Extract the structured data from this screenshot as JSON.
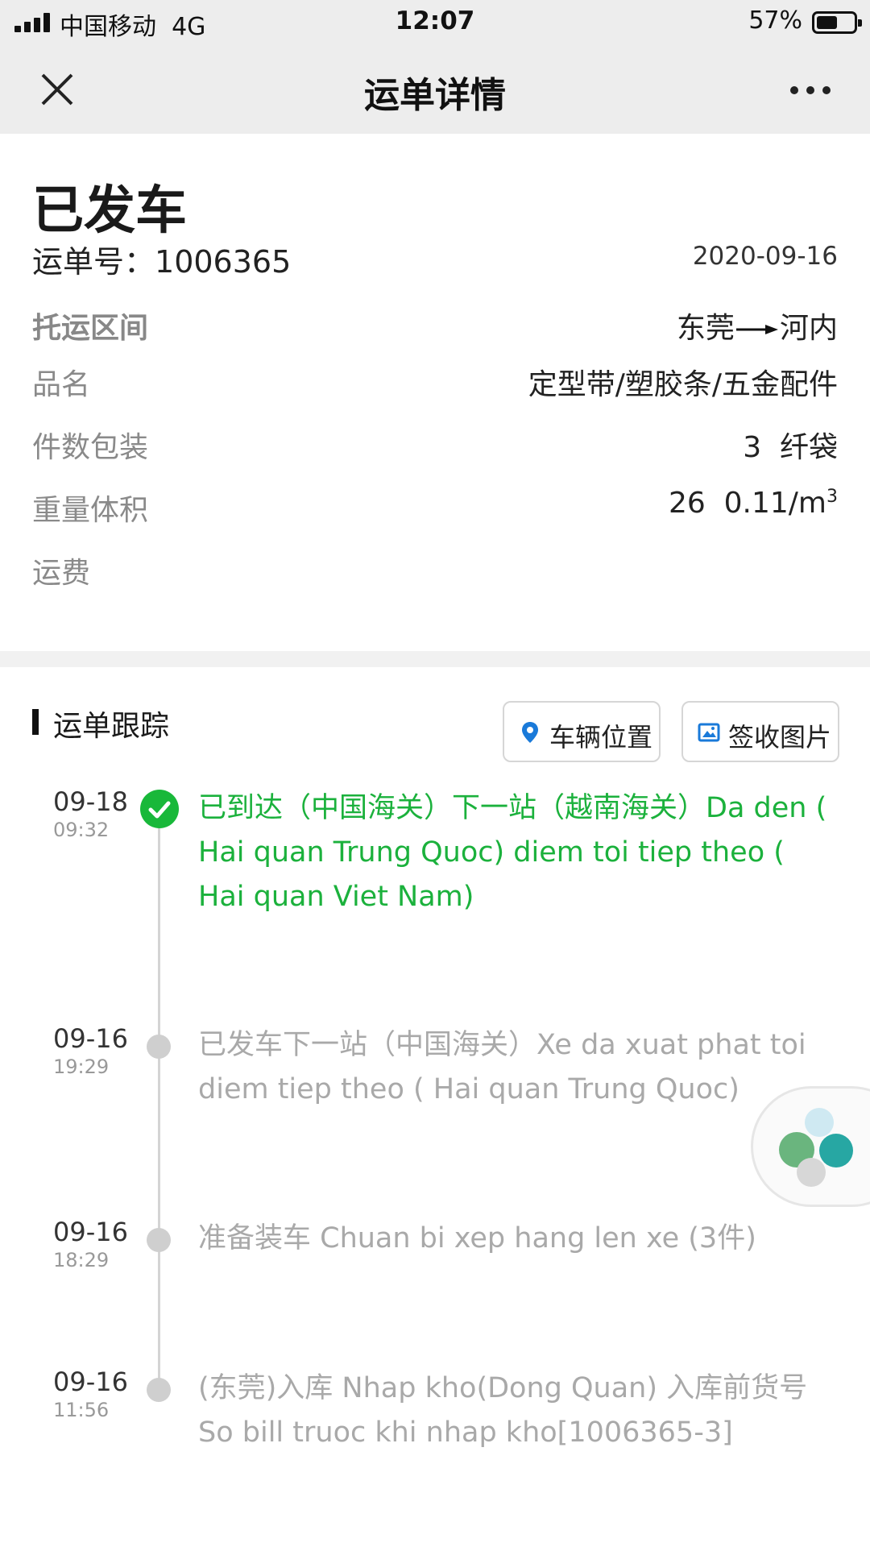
{
  "status_bar": {
    "carrier": "中国移动",
    "network": "4G",
    "time": "12:07",
    "battery": "57%",
    "battery_level": 0.57
  },
  "nav": {
    "title": "运单详情"
  },
  "summary": {
    "status": "已发车",
    "waybill_label": "运单号：",
    "waybill_no": "1006365",
    "date": "2020-09-16",
    "route": {
      "label": "托运区间",
      "from": "东莞",
      "to": "河内"
    },
    "product": {
      "label": "品名",
      "value": "定型带/塑胶条/五金配件"
    },
    "package": {
      "label": "件数包装",
      "value": "3  纤袋"
    },
    "weight": {
      "label": "重量体积",
      "value": "26  0.11/m",
      "unit_sup": "3"
    },
    "freight": {
      "label": "运费",
      "value": ""
    }
  },
  "tracking": {
    "title": "运单跟踪",
    "vehicle_button": "车辆位置",
    "photo_button": "签收图片",
    "events": [
      {
        "date": "09-18",
        "time": "09:32",
        "text": "已到达（中国海关）下一站（越南海关）Da den ( Hai quan Trung Quoc) diem toi tiep theo ( Hai quan Viet Nam)",
        "current": true
      },
      {
        "date": "09-16",
        "time": "19:29",
        "text": "已发车下一站（中国海关）Xe da xuat phat toi diem tiep theo ( Hai quan Trung Quoc)",
        "current": false
      },
      {
        "date": "09-16",
        "time": "18:29",
        "text": "准备装车 Chuan bi xep hang len xe (3件)",
        "current": false
      },
      {
        "date": "09-16",
        "time": "11:56",
        "text": "(东莞)入库 Nhap kho(Dong Quan) 入库前货号 So bill truoc khi nhap kho[1006365-3]",
        "current": false
      }
    ]
  },
  "colors": {
    "accent_green": "#1bb13c",
    "nav_bg": "#ededed",
    "icon_blue": "#1a7ad9"
  }
}
